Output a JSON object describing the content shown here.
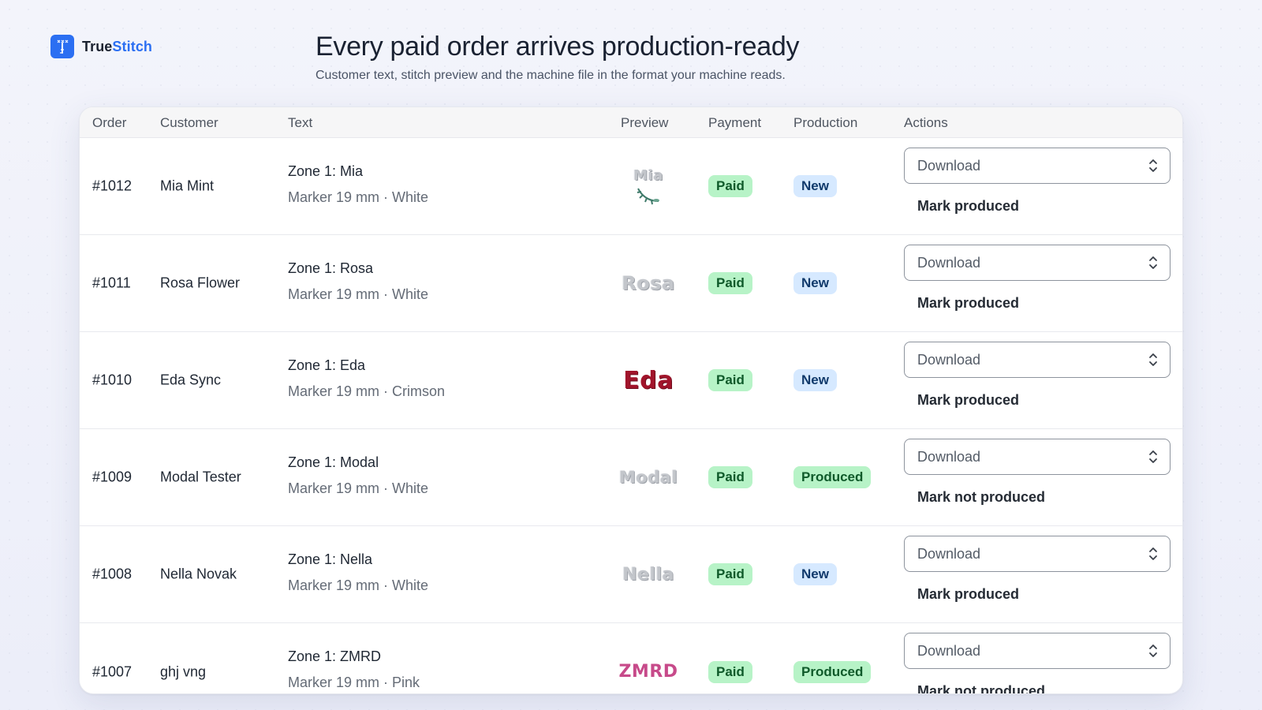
{
  "brand": {
    "name_part1": "True",
    "name_part2": "Stitch"
  },
  "hero": {
    "title": "Every paid order arrives production-ready",
    "subtitle": "Customer text, stitch preview and the machine file in the format your machine reads."
  },
  "table": {
    "headers": {
      "order": "Order",
      "customer": "Customer",
      "text": "Text",
      "preview": "Preview",
      "payment": "Payment",
      "production": "Production",
      "actions": "Actions"
    },
    "rows": [
      {
        "order": "#1012",
        "customer": "Mia Mint",
        "text_line1": "Zone 1: Mia",
        "text_line2": "Marker 19 mm · White",
        "preview_text": "Mia",
        "payment": "Paid",
        "production": "New",
        "download": "Download",
        "mark": "Mark produced"
      },
      {
        "order": "#1011",
        "customer": "Rosa Flower",
        "text_line1": "Zone 1: Rosa",
        "text_line2": "Marker 19 mm · White",
        "preview_text": "Rosa",
        "payment": "Paid",
        "production": "New",
        "download": "Download",
        "mark": "Mark produced"
      },
      {
        "order": "#1010",
        "customer": "Eda Sync",
        "text_line1": "Zone 1: Eda",
        "text_line2": "Marker 19 mm · Crimson",
        "preview_text": "Eda",
        "payment": "Paid",
        "production": "New",
        "download": "Download",
        "mark": "Mark produced"
      },
      {
        "order": "#1009",
        "customer": "Modal Tester",
        "text_line1": "Zone 1: Modal",
        "text_line2": "Marker 19 mm · White",
        "preview_text": "Modal",
        "payment": "Paid",
        "production": "Produced",
        "download": "Download",
        "mark": "Mark not produced"
      },
      {
        "order": "#1008",
        "customer": "Nella Novak",
        "text_line1": "Zone 1: Nella",
        "text_line2": "Marker 19 mm · White",
        "preview_text": "Nella",
        "payment": "Paid",
        "production": "New",
        "download": "Download",
        "mark": "Mark produced"
      },
      {
        "order": "#1007",
        "customer": "ghj vng",
        "text_line1": "Zone 1: ZMRD",
        "text_line2": "Marker 19 mm · Pink",
        "preview_text": "ZMRD",
        "payment": "Paid",
        "production": "Produced",
        "download": "Download",
        "mark": "Mark not produced"
      }
    ]
  },
  "colors": {
    "brand_blue": "#2b6ff2",
    "paid_green": "#b7f3c7",
    "new_blue": "#d6e9ff",
    "crimson": "#a1142b",
    "pink": "#c74a8a"
  }
}
